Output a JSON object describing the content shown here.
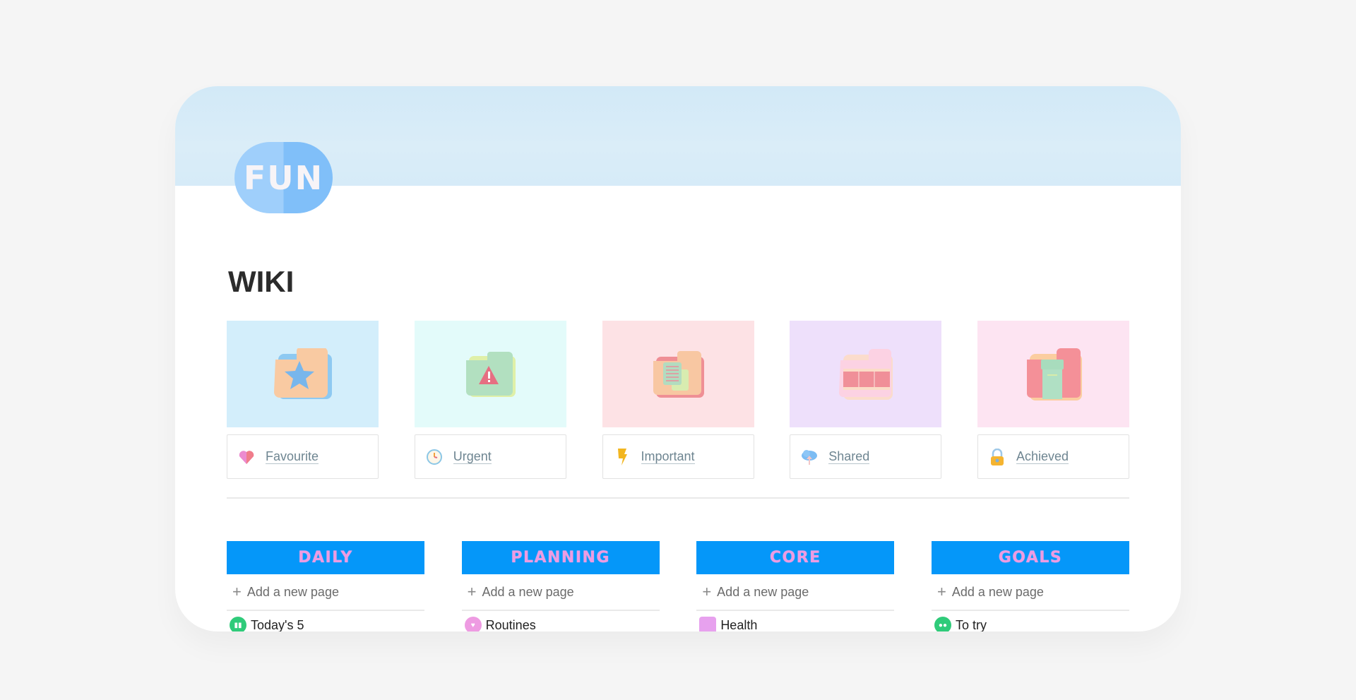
{
  "header": {
    "badge_text": "FUN",
    "page_title": "WIKI"
  },
  "colors": {
    "cover": "#d6ebf8",
    "badge_light": "#9fcffb",
    "badge_dark": "#80bff9",
    "column_header_bg": "#0597f9",
    "column_header_text": "#ee9be2"
  },
  "gallery": [
    {
      "label": "Favourite",
      "icon": "heart-icon",
      "cover_color": "#d3eefb",
      "folder_icon": "star-folder-icon"
    },
    {
      "label": "Urgent",
      "icon": "clock-icon",
      "cover_color": "#e3fbfa",
      "folder_icon": "warning-folder-icon"
    },
    {
      "label": "Important",
      "icon": "lightning-icon",
      "cover_color": "#fde2e5",
      "folder_icon": "document-folder-icon"
    },
    {
      "label": "Shared",
      "icon": "cloud-upload-icon",
      "cover_color": "#eee0fb",
      "folder_icon": "film-folder-icon"
    },
    {
      "label": "Achieved",
      "icon": "lock-icon",
      "cover_color": "#fde4f2",
      "folder_icon": "archive-folder-icon"
    }
  ],
  "columns": [
    {
      "title": "DAILY",
      "add_label": "Add a new page",
      "items": [
        {
          "label": "Today's 5",
          "icon": "chart-icon",
          "color": "#2fcb7a"
        }
      ]
    },
    {
      "title": "PLANNING",
      "add_label": "Add a new page",
      "items": [
        {
          "label": "Routines",
          "icon": "badge-icon",
          "color": "#ee9be2"
        }
      ]
    },
    {
      "title": "CORE",
      "add_label": "Add a new page",
      "items": [
        {
          "label": "Health",
          "icon": "health-icon",
          "color": "#e7a1ee"
        }
      ]
    },
    {
      "title": "GOALS",
      "add_label": "Add a new page",
      "items": [
        {
          "label": "To try",
          "icon": "eyes-icon",
          "color": "#2fcb7a"
        }
      ]
    }
  ]
}
